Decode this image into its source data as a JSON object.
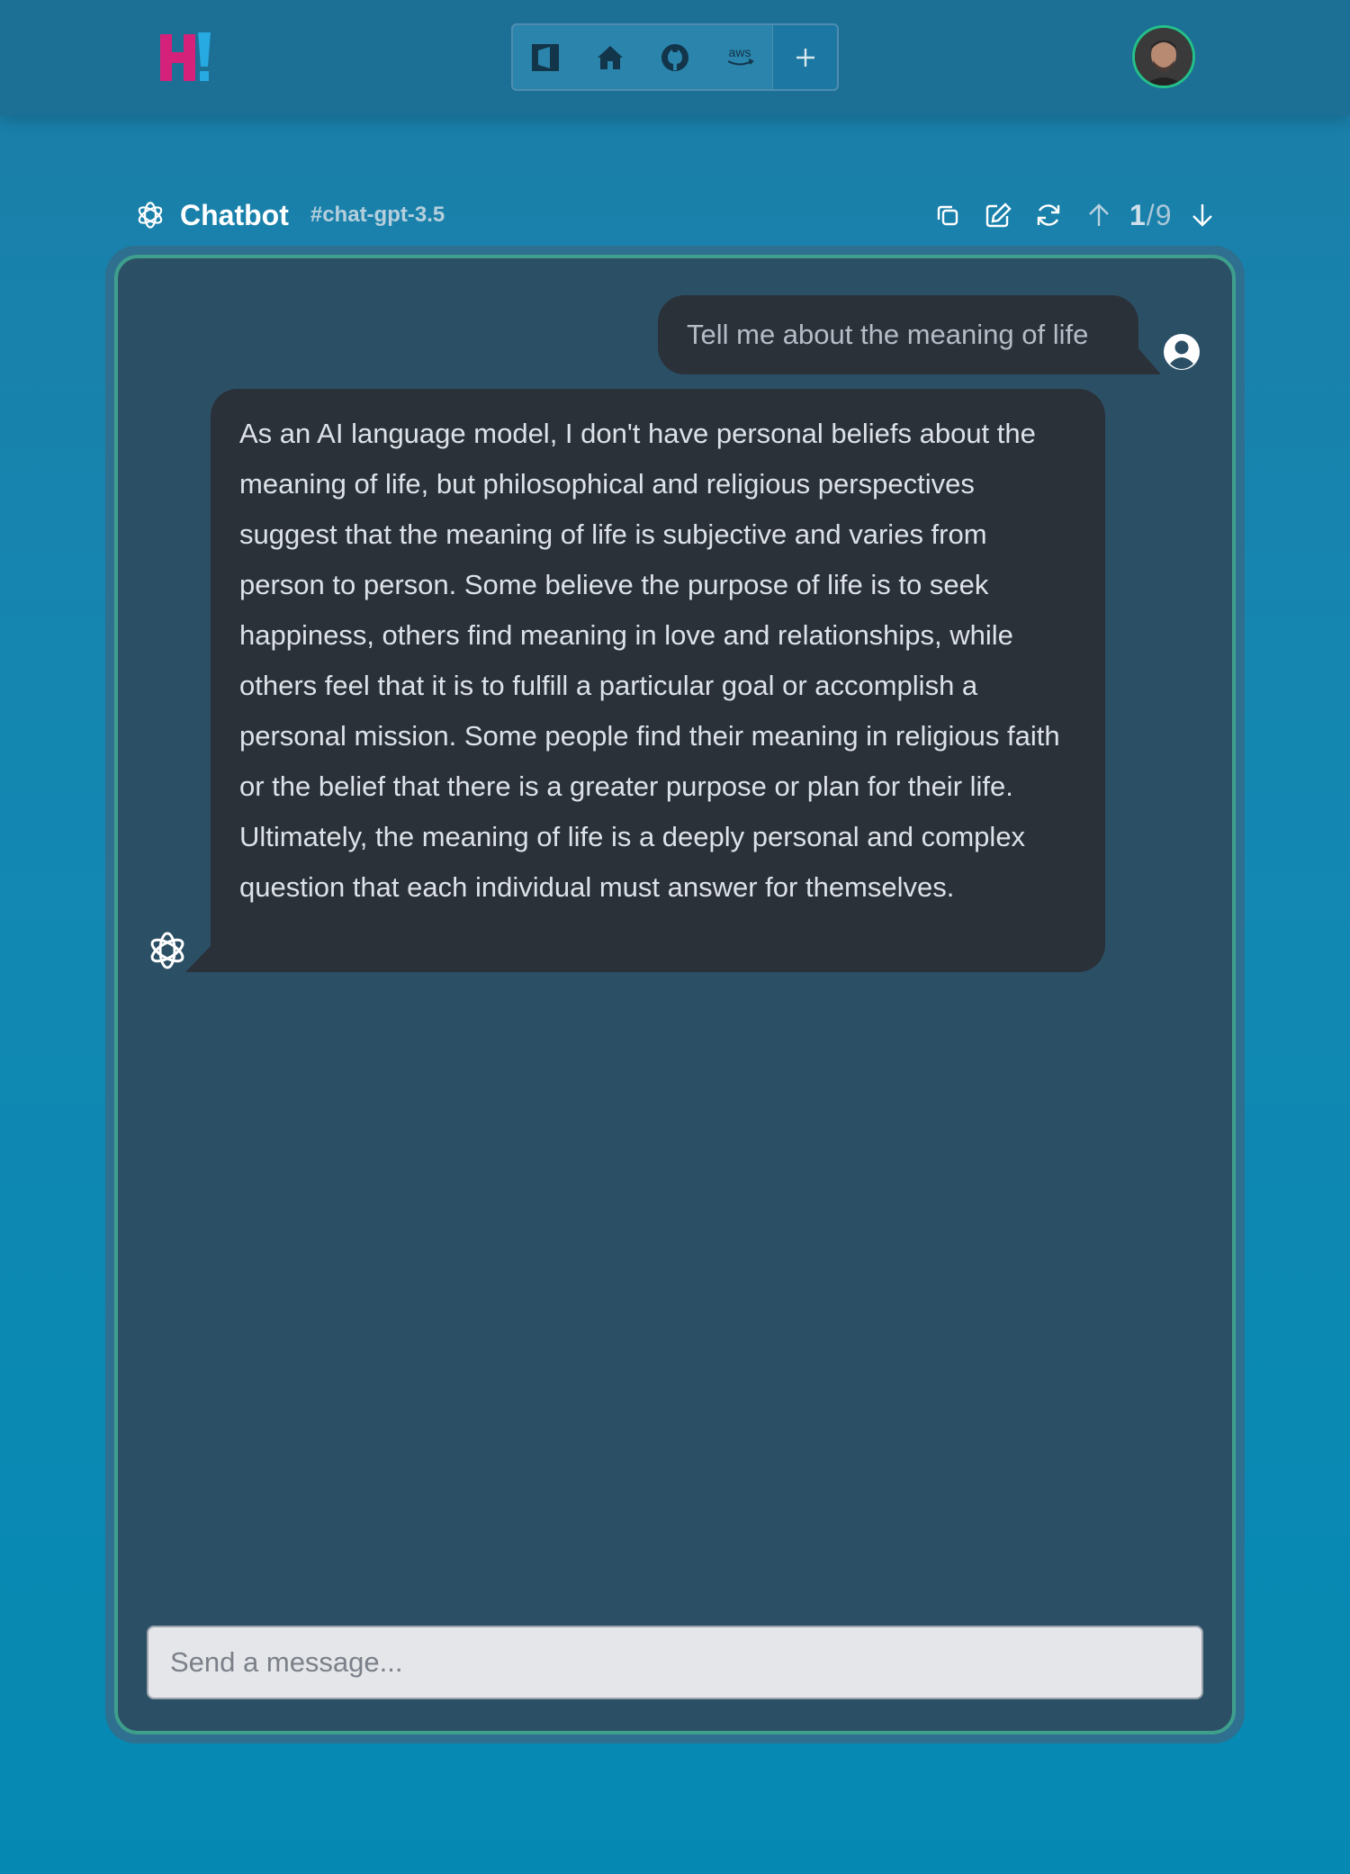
{
  "nav": {
    "logo": "H!",
    "links": [
      {
        "icon": "sidebar-square-icon"
      },
      {
        "icon": "home-icon"
      },
      {
        "icon": "github-icon"
      },
      {
        "icon": "aws-icon",
        "label": "aws"
      }
    ],
    "add_icon": "plus-icon",
    "user_avatar": "user-avatar"
  },
  "chat": {
    "title": "Chatbot",
    "tag": "#chat-gpt-3.5",
    "toolbar": {
      "icons": [
        "copy-icon",
        "edit-icon",
        "refresh-icon",
        "arrow-up-icon",
        "arrow-down-icon"
      ],
      "page_current": "1",
      "page_separator": "/",
      "page_total": "9"
    },
    "messages": [
      {
        "role": "user",
        "text": "Tell me about the meaning of life"
      },
      {
        "role": "assistant",
        "text": "As an AI language model, I don't have personal beliefs about the meaning of life, but philosophical and religious perspectives suggest that the meaning of life is subjective and varies from person to person. Some believe the purpose of life is to seek happiness, others find meaning in love and relationships, while others feel that it is to fulfill a particular goal or accomplish a personal mission. Some people find their meaning in religious faith or the belief that there is a greater purpose or plan for their life. Ultimately, the meaning of life is a deeply personal and complex question that each individual must answer for themselves."
      }
    ],
    "input": {
      "placeholder": "Send a message...",
      "value": ""
    }
  },
  "colors": {
    "logo_pink": "#d6217a",
    "logo_blue": "#27a9e1",
    "panel_border": "#3e9f8d",
    "bubble": "#2b3139"
  }
}
